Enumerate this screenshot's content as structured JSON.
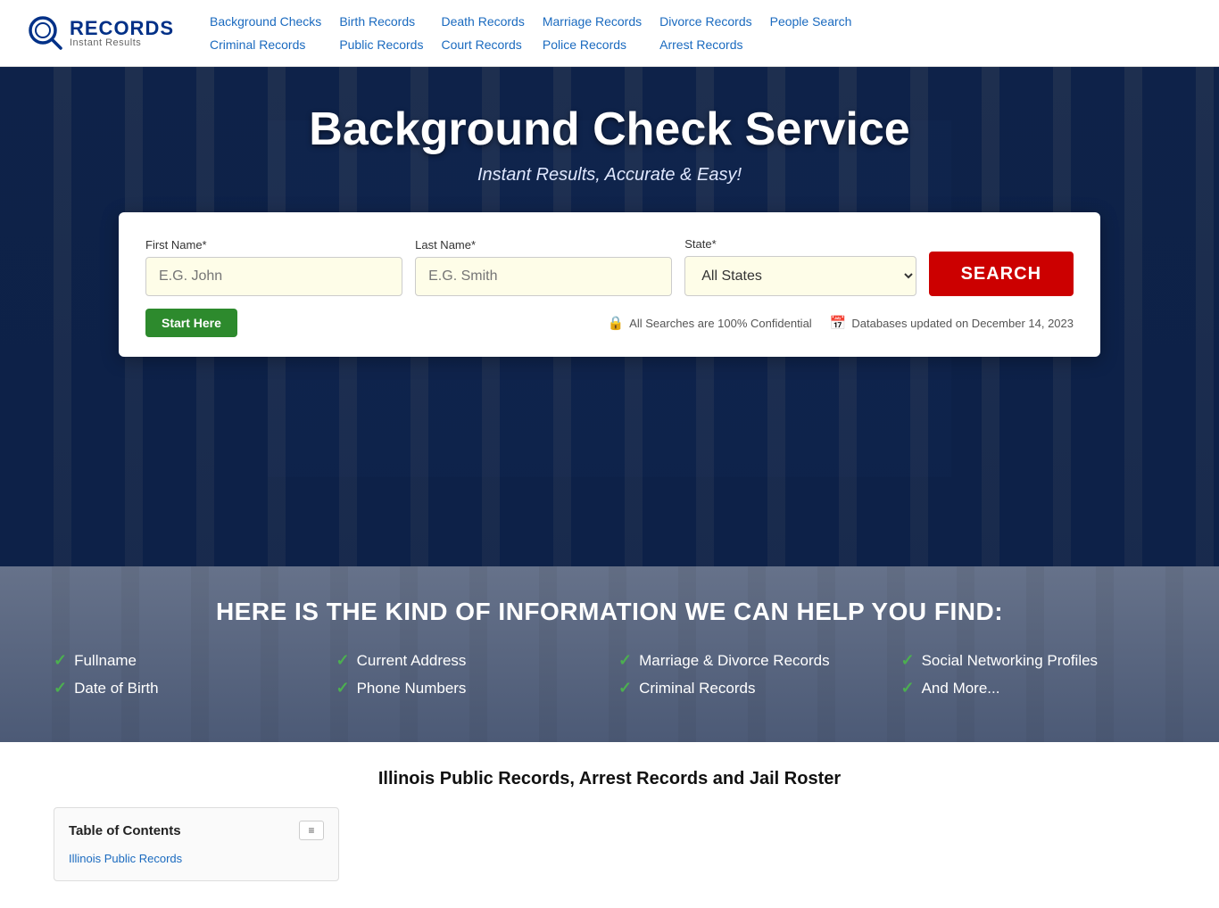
{
  "logo": {
    "main": "RECORDS",
    "sub": "Instant Results"
  },
  "nav": {
    "row1": [
      {
        "label": "Background Checks",
        "href": "#"
      },
      {
        "label": "Birth Records",
        "href": "#"
      },
      {
        "label": "Death Records",
        "href": "#"
      },
      {
        "label": "Marriage Records",
        "href": "#"
      },
      {
        "label": "Divorce Records",
        "href": "#"
      },
      {
        "label": "People Search",
        "href": "#"
      }
    ],
    "row2": [
      {
        "label": "Criminal Records",
        "href": "#"
      },
      {
        "label": "Public Records",
        "href": "#"
      },
      {
        "label": "Court Records",
        "href": "#"
      },
      {
        "label": "Police Records",
        "href": "#"
      },
      {
        "label": "Arrest Records",
        "href": "#"
      }
    ]
  },
  "hero": {
    "title": "Background Check Service",
    "subtitle": "Instant Results, Accurate & Easy!"
  },
  "search": {
    "first_name_label": "First Name*",
    "first_name_placeholder": "E.G. John",
    "last_name_label": "Last Name*",
    "last_name_placeholder": "E.G. Smith",
    "state_label": "State*",
    "state_default": "All States",
    "search_button": "SEARCH",
    "start_here_button": "Start Here",
    "meta_confidential": "All Searches are 100% Confidential",
    "meta_database": "Databases updated on December 14, 2023"
  },
  "info": {
    "title": "HERE IS THE KIND OF INFORMATION WE CAN HELP YOU FIND:",
    "items": [
      [
        "Fullname",
        "Current Address",
        "Marriage & Divorce Records",
        "Social Networking Profiles"
      ],
      [
        "Date of Birth",
        "Phone Numbers",
        "Criminal Records",
        "And More..."
      ]
    ]
  },
  "content": {
    "title": "Illinois Public Records, Arrest Records and Jail Roster",
    "toc": {
      "heading": "Table of Contents",
      "items": [
        "Illinois Public Records"
      ]
    }
  }
}
